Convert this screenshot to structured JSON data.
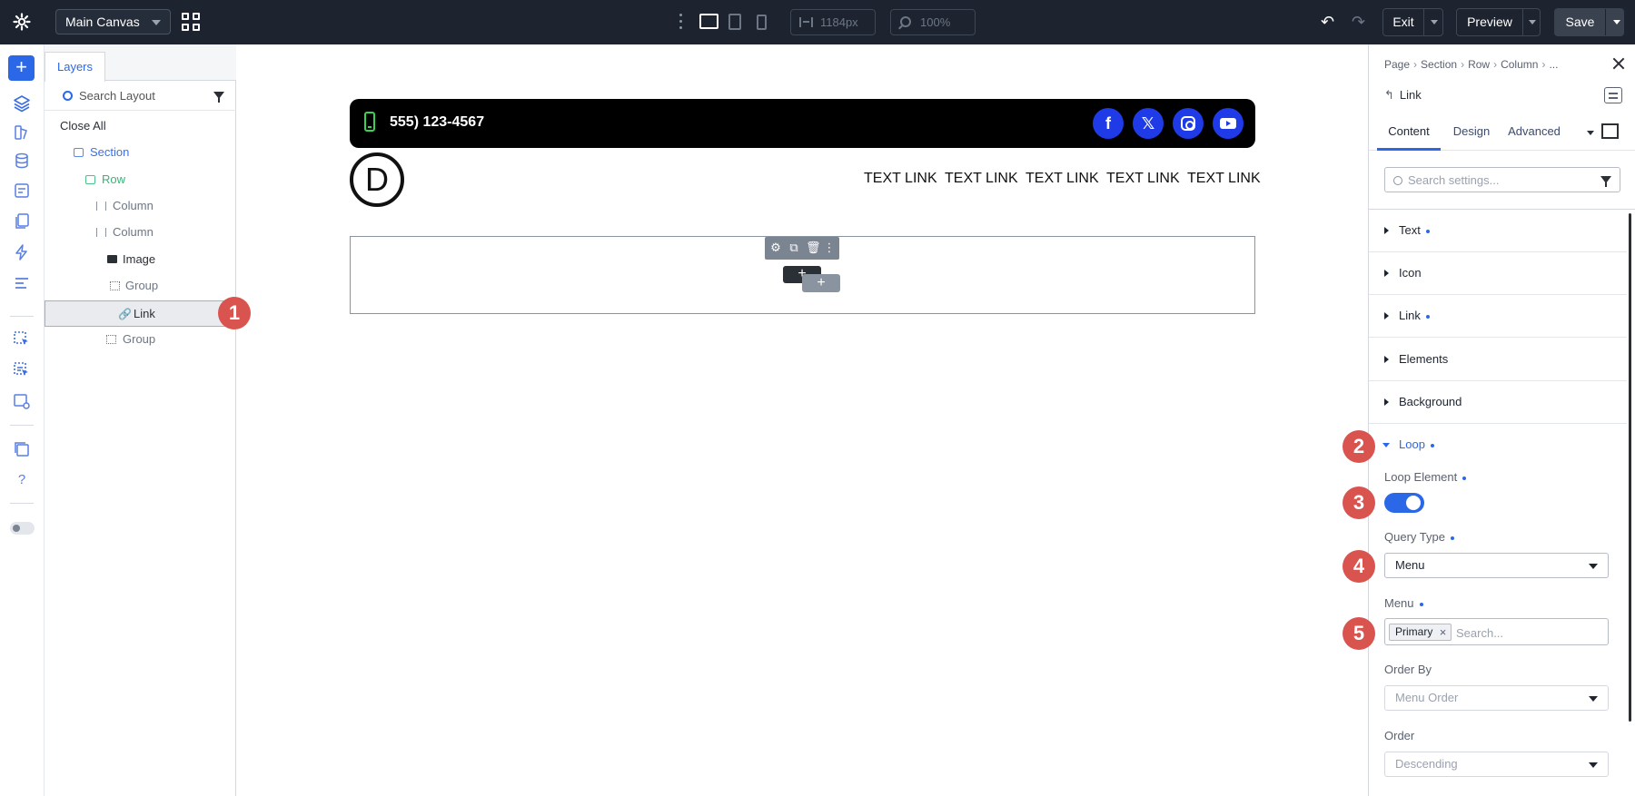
{
  "topbar": {
    "canvas_select": "Main Canvas",
    "width_value": "1184px",
    "zoom_value": "100%",
    "exit_label": "Exit",
    "preview_label": "Preview",
    "save_label": "Save"
  },
  "layers": {
    "tab_label": "Layers",
    "search_placeholder": "Search Layout",
    "close_all": "Close All",
    "items": [
      "Section",
      "Row",
      "Column",
      "Column",
      "Image",
      "Group",
      "Link",
      "Group"
    ]
  },
  "canvas": {
    "phone": "555) 123-4567",
    "logo_letter": "D",
    "nav_links": [
      "TEXT LINK",
      "TEXT LINK",
      "TEXT LINK",
      "TEXT LINK",
      "TEXT LINK"
    ]
  },
  "settings": {
    "breadcrumb": [
      "Page",
      "Section",
      "Row",
      "Column",
      "..."
    ],
    "module_title": "Link",
    "tabs": [
      "Content",
      "Design",
      "Advanced"
    ],
    "search_placeholder": "Search settings...",
    "groups": [
      "Text",
      "Icon",
      "Link",
      "Elements",
      "Background",
      "Loop"
    ],
    "loop_element_label": "Loop Element",
    "query_type_label": "Query Type",
    "query_type_value": "Menu",
    "menu_label": "Menu",
    "menu_chip": "Primary",
    "menu_search_placeholder": "Search...",
    "order_by_label": "Order By",
    "order_by_value": "Menu Order",
    "order_label": "Order",
    "order_value": "Descending"
  },
  "badges": [
    "1",
    "2",
    "3",
    "4",
    "5"
  ],
  "colors": {
    "accent": "#2a68e8",
    "topbar": "#1d2430",
    "badge": "#d9534f",
    "social": "#1f3be8",
    "phone_icon": "#39d353"
  }
}
